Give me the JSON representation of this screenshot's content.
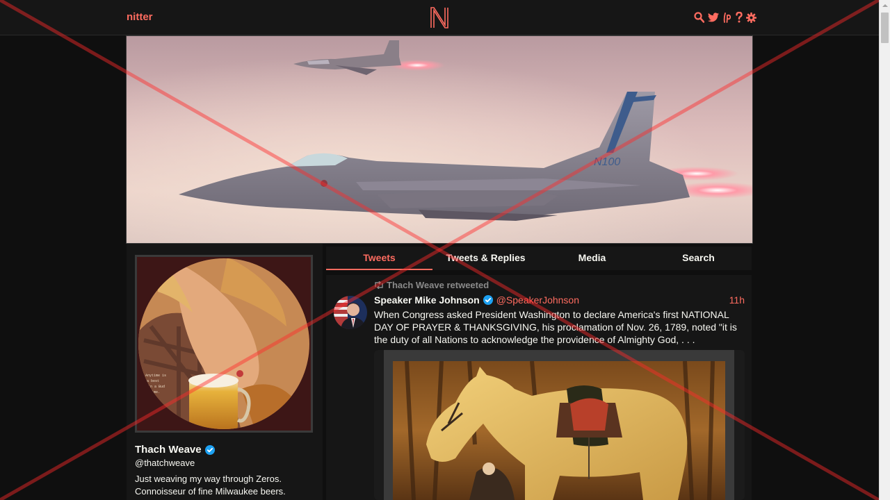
{
  "navbar": {
    "brand": "nitter",
    "icons": [
      "search-icon",
      "twitter-bird-icon",
      "rss-icon",
      "help-icon",
      "settings-icon"
    ],
    "rss_glyph": "ℹ",
    "accent": "#ff6c60"
  },
  "profile": {
    "fullname": "Thach Weave",
    "username": "@thatchweave",
    "bio": "Just weaving my way through Zeros. Connoisseur of fine Milwaukee beers.",
    "verified": true
  },
  "tabs": [
    {
      "label": "Tweets",
      "active": true
    },
    {
      "label": "Tweets & Replies",
      "active": false
    },
    {
      "label": "Media",
      "active": false
    },
    {
      "label": "Search",
      "active": false
    }
  ],
  "tweet": {
    "retweet_header": "Thach Weave retweeted",
    "fullname": "Speaker Mike Johnson",
    "username": "@SpeakerJohnson",
    "date": "11h",
    "verified": true,
    "text": "When Congress asked President Washington to declare America's first NATIONAL DAY OF PRAYER & THANKSGIVING, his proclamation of Nov. 26, 1789, noted \"it is the duty of all Nations to acknowledge the providence of Almighty God, . . ."
  },
  "colors": {
    "background": "#0f0f0f",
    "panel": "#161616",
    "accent": "#ff6c60",
    "verified": "#1da1f2"
  }
}
